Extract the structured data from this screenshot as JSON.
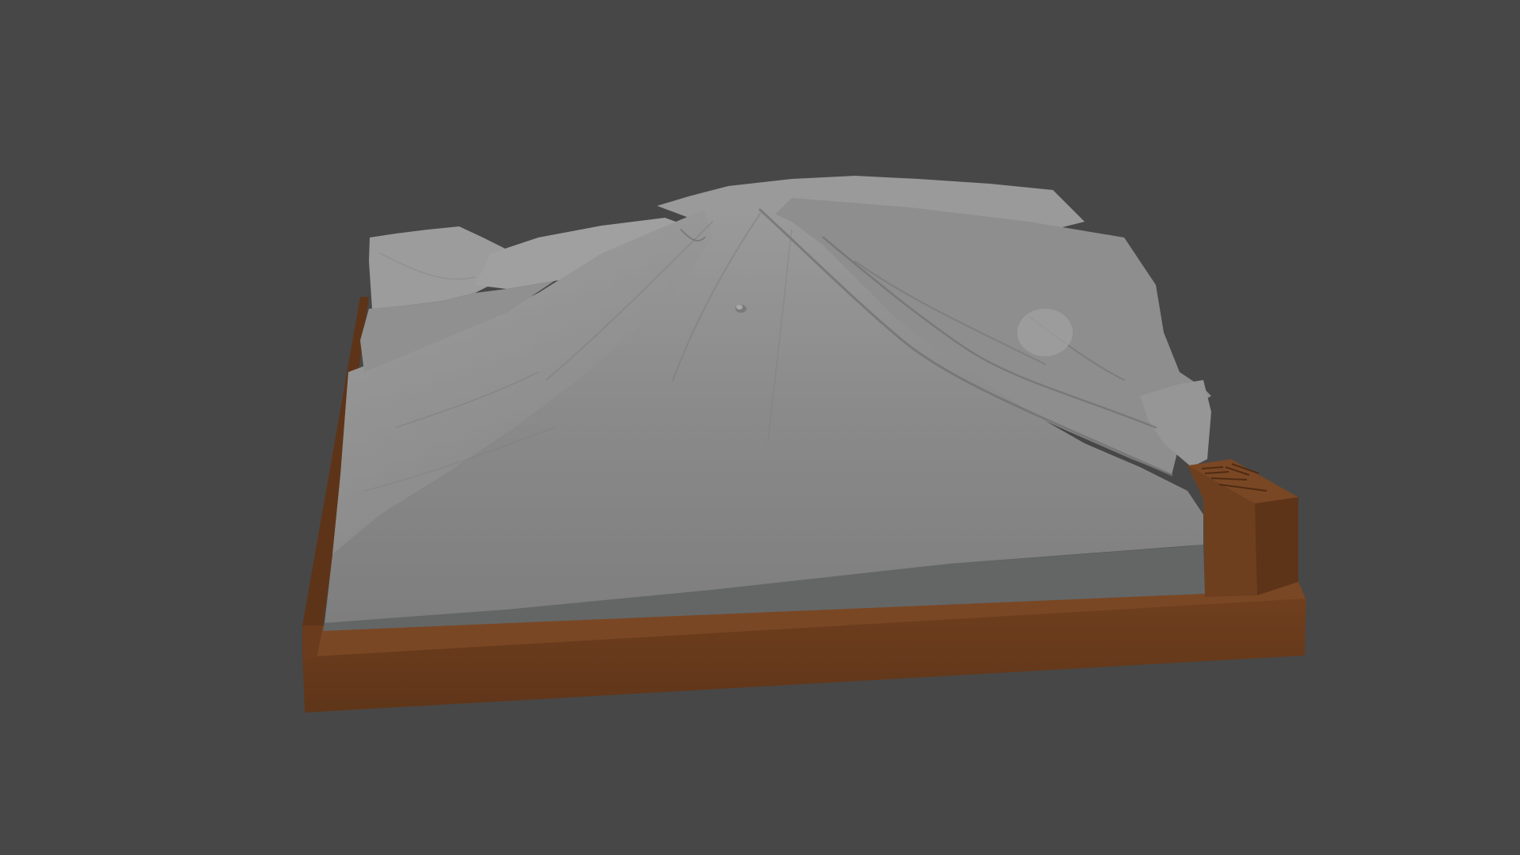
{
  "viewport": {
    "background_color": "#474747"
  },
  "model": {
    "terrain_color": "#8c8c8c",
    "terrain_front_color": "#646666",
    "base_color": "#6e3f1f",
    "base_top_color": "#7a4724",
    "label_block_color": "#6e3f1f"
  }
}
